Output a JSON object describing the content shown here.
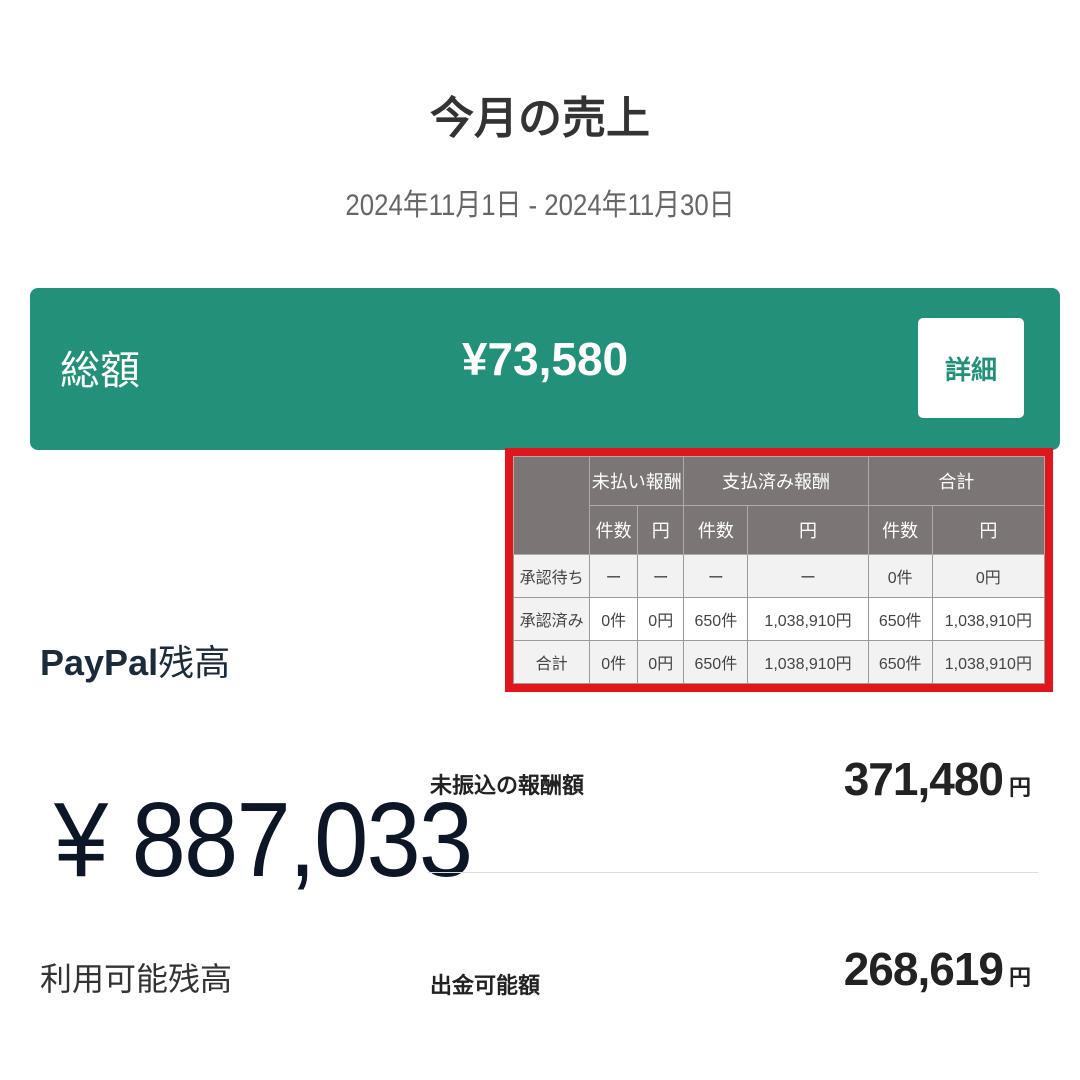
{
  "header": {
    "title": "今月の売上",
    "date_range": "2024年11月1日 - 2024年11月30日"
  },
  "total": {
    "label": "総額",
    "amount": "¥73,580",
    "detail_label": "詳細"
  },
  "summary_table": {
    "groups": [
      "未払い報酬",
      "支払済み報酬",
      "合計"
    ],
    "subheaders": [
      "件数",
      "円",
      "件数",
      "円",
      "件数",
      "円"
    ],
    "rows": [
      {
        "label": "承認待ち",
        "cells": [
          "ー",
          "ー",
          "ー",
          "ー",
          "0件",
          "0円"
        ]
      },
      {
        "label": "承認済み",
        "cells": [
          "0件",
          "0円",
          "650件",
          "1,038,910円",
          "650件",
          "1,038,910円"
        ]
      },
      {
        "label": "合計",
        "cells": [
          "0件",
          "0円",
          "650件",
          "1,038,910円",
          "650件",
          "1,038,910円"
        ]
      }
    ]
  },
  "paypal": {
    "brand": "PayPal",
    "suffix": "残高",
    "balance": "¥ 887,033",
    "caption": "利用可能残高"
  },
  "payouts": [
    {
      "label": "未振込の報酬額",
      "value": "371,480",
      "unit": "円"
    },
    {
      "label": "出金可能額",
      "value": "268,619",
      "unit": "円"
    }
  ],
  "colors": {
    "accent": "#23917a",
    "table_header": "#7b7575",
    "highlight_border": "#e0161c"
  }
}
